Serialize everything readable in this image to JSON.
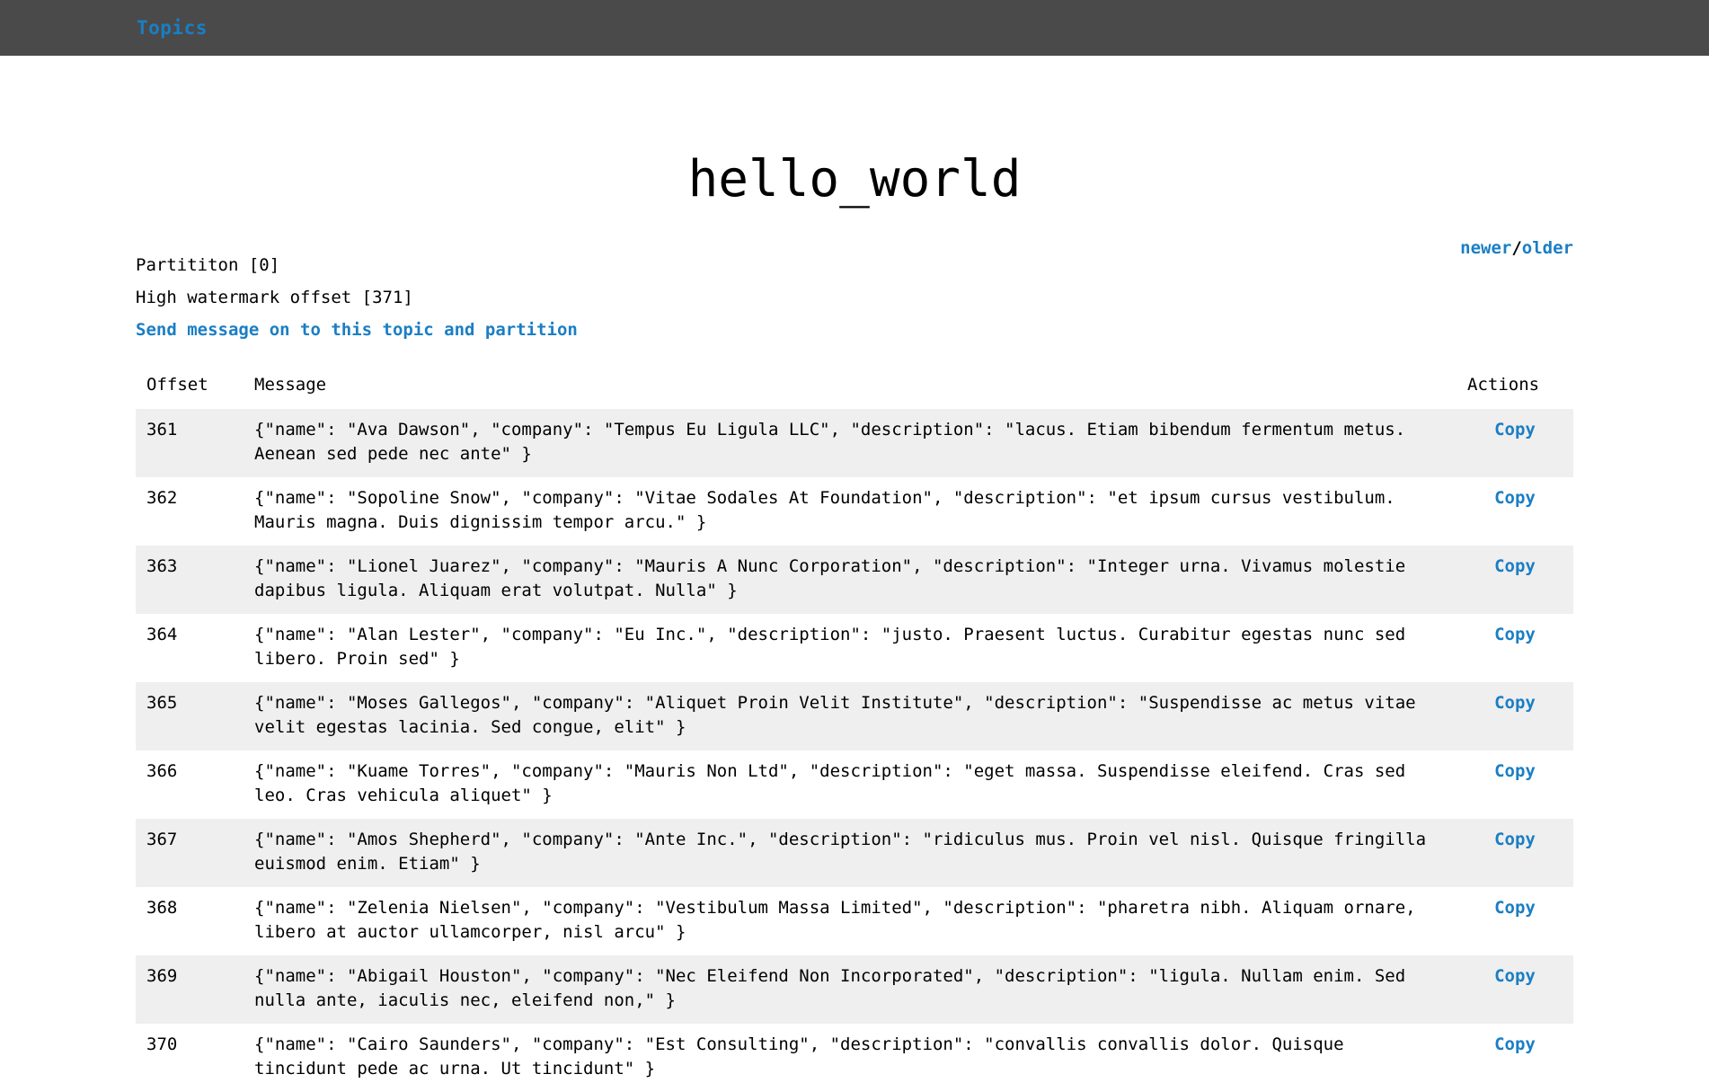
{
  "navbar": {
    "brand": "Topics"
  },
  "header": {
    "title": "hello_world"
  },
  "meta": {
    "partition": "Partititon [0]",
    "high_watermark": "High watermark offset [371]",
    "send_message_link": "Send message on to this topic and partition"
  },
  "pager": {
    "newer": "newer",
    "separator": "/",
    "older": "older"
  },
  "table": {
    "headers": {
      "offset": "Offset",
      "message": "Message",
      "actions": "Actions"
    },
    "action_label": "Copy",
    "rows": [
      {
        "offset": "361",
        "message": "{\"name\": \"Ava Dawson\", \"company\": \"Tempus Eu Ligula LLC\", \"description\": \"lacus. Etiam bibendum fermentum metus. Aenean sed pede nec ante\" }",
        "action": "Copy"
      },
      {
        "offset": "362",
        "message": "{\"name\": \"Sopoline Snow\", \"company\": \"Vitae Sodales At Foundation\", \"description\": \"et ipsum cursus vestibulum. Mauris magna. Duis dignissim tempor arcu.\" }",
        "action": "Copy"
      },
      {
        "offset": "363",
        "message": "{\"name\": \"Lionel Juarez\", \"company\": \"Mauris A Nunc Corporation\", \"description\": \"Integer urna. Vivamus molestie dapibus ligula. Aliquam erat volutpat. Nulla\" }",
        "action": "Copy"
      },
      {
        "offset": "364",
        "message": "{\"name\": \"Alan Lester\", \"company\": \"Eu Inc.\", \"description\": \"justo. Praesent luctus. Curabitur egestas nunc sed libero. Proin sed\" }",
        "action": "Copy"
      },
      {
        "offset": "365",
        "message": "{\"name\": \"Moses Gallegos\", \"company\": \"Aliquet Proin Velit Institute\", \"description\": \"Suspendisse ac metus vitae velit egestas lacinia. Sed congue, elit\" }",
        "action": "Copy"
      },
      {
        "offset": "366",
        "message": "{\"name\": \"Kuame Torres\", \"company\": \"Mauris Non Ltd\", \"description\": \"eget massa. Suspendisse eleifend. Cras sed leo. Cras vehicula aliquet\" }",
        "action": "Copy"
      },
      {
        "offset": "367",
        "message": "{\"name\": \"Amos Shepherd\", \"company\": \"Ante Inc.\", \"description\": \"ridiculus mus. Proin vel nisl. Quisque fringilla euismod enim. Etiam\" }",
        "action": "Copy"
      },
      {
        "offset": "368",
        "message": "{\"name\": \"Zelenia Nielsen\", \"company\": \"Vestibulum Massa Limited\", \"description\": \"pharetra nibh. Aliquam ornare, libero at auctor ullamcorper, nisl arcu\" }",
        "action": "Copy"
      },
      {
        "offset": "369",
        "message": "{\"name\": \"Abigail Houston\", \"company\": \"Nec Eleifend Non Incorporated\", \"description\": \"ligula. Nullam enim. Sed nulla ante, iaculis nec, eleifend non,\" }",
        "action": "Copy"
      },
      {
        "offset": "370",
        "message": "{\"name\": \"Cairo Saunders\", \"company\": \"Est Consulting\", \"description\": \"convallis convallis dolor. Quisque tincidunt pede ac urna. Ut tincidunt\" }",
        "action": "Copy"
      }
    ]
  },
  "colors": {
    "navbar_bg": "#4a4a4a",
    "link": "#1a7ec4",
    "row_stripe": "#efefef"
  }
}
